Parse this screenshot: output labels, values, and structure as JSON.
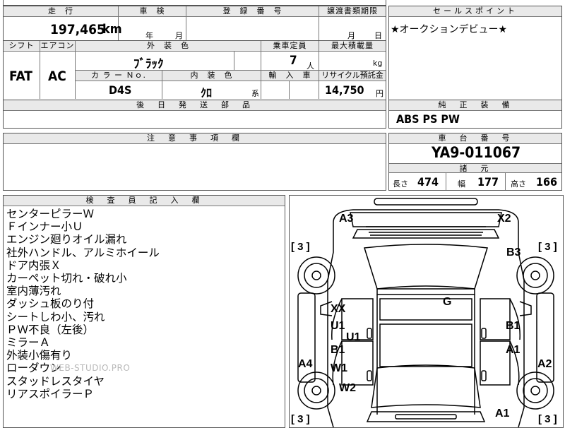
{
  "top": {
    "mileage_label": "走　行",
    "mileage": "197,465",
    "mileage_unit": "km",
    "shaken_label": "車　検",
    "shaken_year": "年",
    "shaken_month": "月",
    "reg_label": "登　録　番　号",
    "transfer_label": "譲渡書類期限",
    "transfer_month": "月",
    "transfer_day": "日"
  },
  "row2": {
    "shift_label": "シフト",
    "shift": "FAT",
    "ac_label": "エアコン",
    "ac": "AC",
    "ext_color_label": "外　装　色",
    "ext_color": "ﾌﾞﾗｯｸ",
    "capacity_label": "乗車定員",
    "capacity": "7",
    "capacity_unit": "人",
    "load_label": "最大積載量",
    "load_unit": "kg",
    "color_no_label": "カ ラ ー Ｎｏ.",
    "color_no": "D4S",
    "int_color_label": "内　装　色",
    "int_color": "ｸﾛ",
    "int_color_suffix": "系",
    "import_label": "輸　入　車",
    "recycle_label": "リサイクル預託金",
    "recycle": "14,750",
    "recycle_unit": "円"
  },
  "later_parts_label": "後　日　発　送　部　品",
  "sales_point": {
    "label": "セールスポイント",
    "text": "★オークションデビュー★"
  },
  "equipment": {
    "label": "純　正　装　備",
    "text": "ABS PS PW"
  },
  "caution_label": "注　意　事　項　欄",
  "chassis": {
    "label": "車　台　番　号",
    "number": "YA9-011067"
  },
  "specs": {
    "label": "諸　元",
    "length_label": "長さ",
    "length": "474",
    "width_label": "幅",
    "width": "177",
    "height_label": "高さ",
    "height": "166"
  },
  "inspector": {
    "label": "検　査　員　記　入　欄",
    "notes": [
      "センターピラーＷ",
      "Ｆインナー小Ｕ",
      "エンジン廻りオイル漏れ",
      "社外ハンドル、アルミホイール",
      "ドア内張Ｘ",
      "カーペット切れ・破れ小",
      "室内薄汚れ",
      "ダッシュ板のり付",
      "シートしわ小、汚れ",
      "ＰＷ不良（左後）",
      "ミラーＡ",
      "外装小傷有り",
      "ローダウン",
      "スタッドレスタイヤ",
      "リアスポイラーＰ"
    ],
    "watermark": "WEB-STUDIO.PRO"
  },
  "damage": {
    "a3": "A3",
    "x2": "X2",
    "b3": "B3",
    "g": "G",
    "xx": "XX",
    "u1_left": "U1",
    "u1_mid": "U1",
    "b1_left": "B1",
    "w1": "W1",
    "a4": "A4",
    "w2": "W2",
    "b1_right": "B1",
    "a1_right": "A1",
    "a2": "A2",
    "a1_bottom": "A1",
    "tire_fl": "[ 3 ]",
    "tire_fr": "[ 3 ]",
    "tire_rl": "[ 3 ]",
    "tire_rr": "[ 3 ]"
  }
}
